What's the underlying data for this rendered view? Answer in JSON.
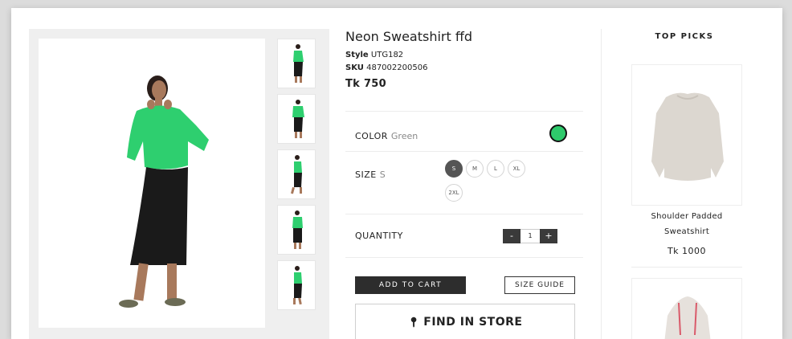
{
  "product": {
    "title": "Neon Sweatshirt ffd",
    "style_label": "Style",
    "style_value": "UTG182",
    "sku_label": "SKU",
    "sku_value": "487002200506",
    "price": "Tk 750"
  },
  "options": {
    "color_label": "COLOR",
    "color_value": "Green",
    "swatch_color": "#2ec96b",
    "size_label": "SIZE",
    "size_value": "S",
    "sizes": [
      "S",
      "M",
      "L",
      "XL",
      "2XL"
    ],
    "quantity_label": "QUANTITY",
    "quantity_minus": "-",
    "quantity_value": "1",
    "quantity_plus": "+"
  },
  "actions": {
    "add_to_cart": "ADD TO CART",
    "size_guide": "SIZE GUIDE",
    "find_in_store": "FIND IN STORE"
  },
  "top_picks": {
    "title": "TOP PICKS",
    "items": [
      {
        "name_line1": "Shoulder Padded",
        "name_line2": "Sweatshirt",
        "price": "Tk 1000"
      }
    ]
  },
  "colors": {
    "accent_green": "#2ec96b",
    "dark_button": "#2d2d2d"
  }
}
